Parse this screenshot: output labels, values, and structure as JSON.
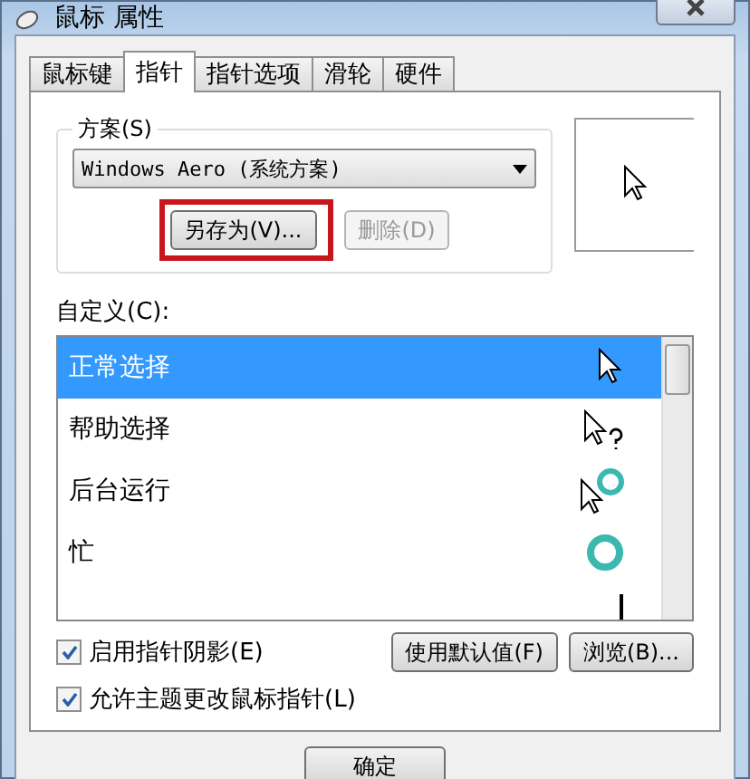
{
  "window": {
    "title": "鼠标 属性"
  },
  "tabs": [
    {
      "label": "鼠标键",
      "selected": false
    },
    {
      "label": "指针",
      "selected": true
    },
    {
      "label": "指针选项",
      "selected": false
    },
    {
      "label": "滑轮",
      "selected": false
    },
    {
      "label": "硬件",
      "selected": false
    }
  ],
  "scheme": {
    "label": "方案(S)",
    "value": "Windows Aero (系统方案)",
    "buttons": [
      {
        "label": "另存为(V)...",
        "disabled": false,
        "highlighted": true
      },
      {
        "label": "删除(D)",
        "disabled": true,
        "highlighted": false
      }
    ]
  },
  "customize": {
    "label": "自定义(C):",
    "items": [
      {
        "label": "正常选择",
        "kind": "arrow",
        "selected": true
      },
      {
        "label": "帮助选择",
        "kind": "help",
        "selected": false
      },
      {
        "label": "后台运行",
        "kind": "working",
        "selected": false
      },
      {
        "label": "忙",
        "kind": "busy",
        "selected": false
      },
      {
        "kind": "text",
        "selected": false
      }
    ]
  },
  "options": [
    {
      "label": "启用指针阴影(E)",
      "checked": true
    },
    {
      "label": "允许主题更改鼠标指针(L)",
      "checked": true
    }
  ],
  "side_buttons": [
    "使用默认值(F)",
    "浏览(B)..."
  ],
  "footer_buttons": [
    "确定"
  ]
}
